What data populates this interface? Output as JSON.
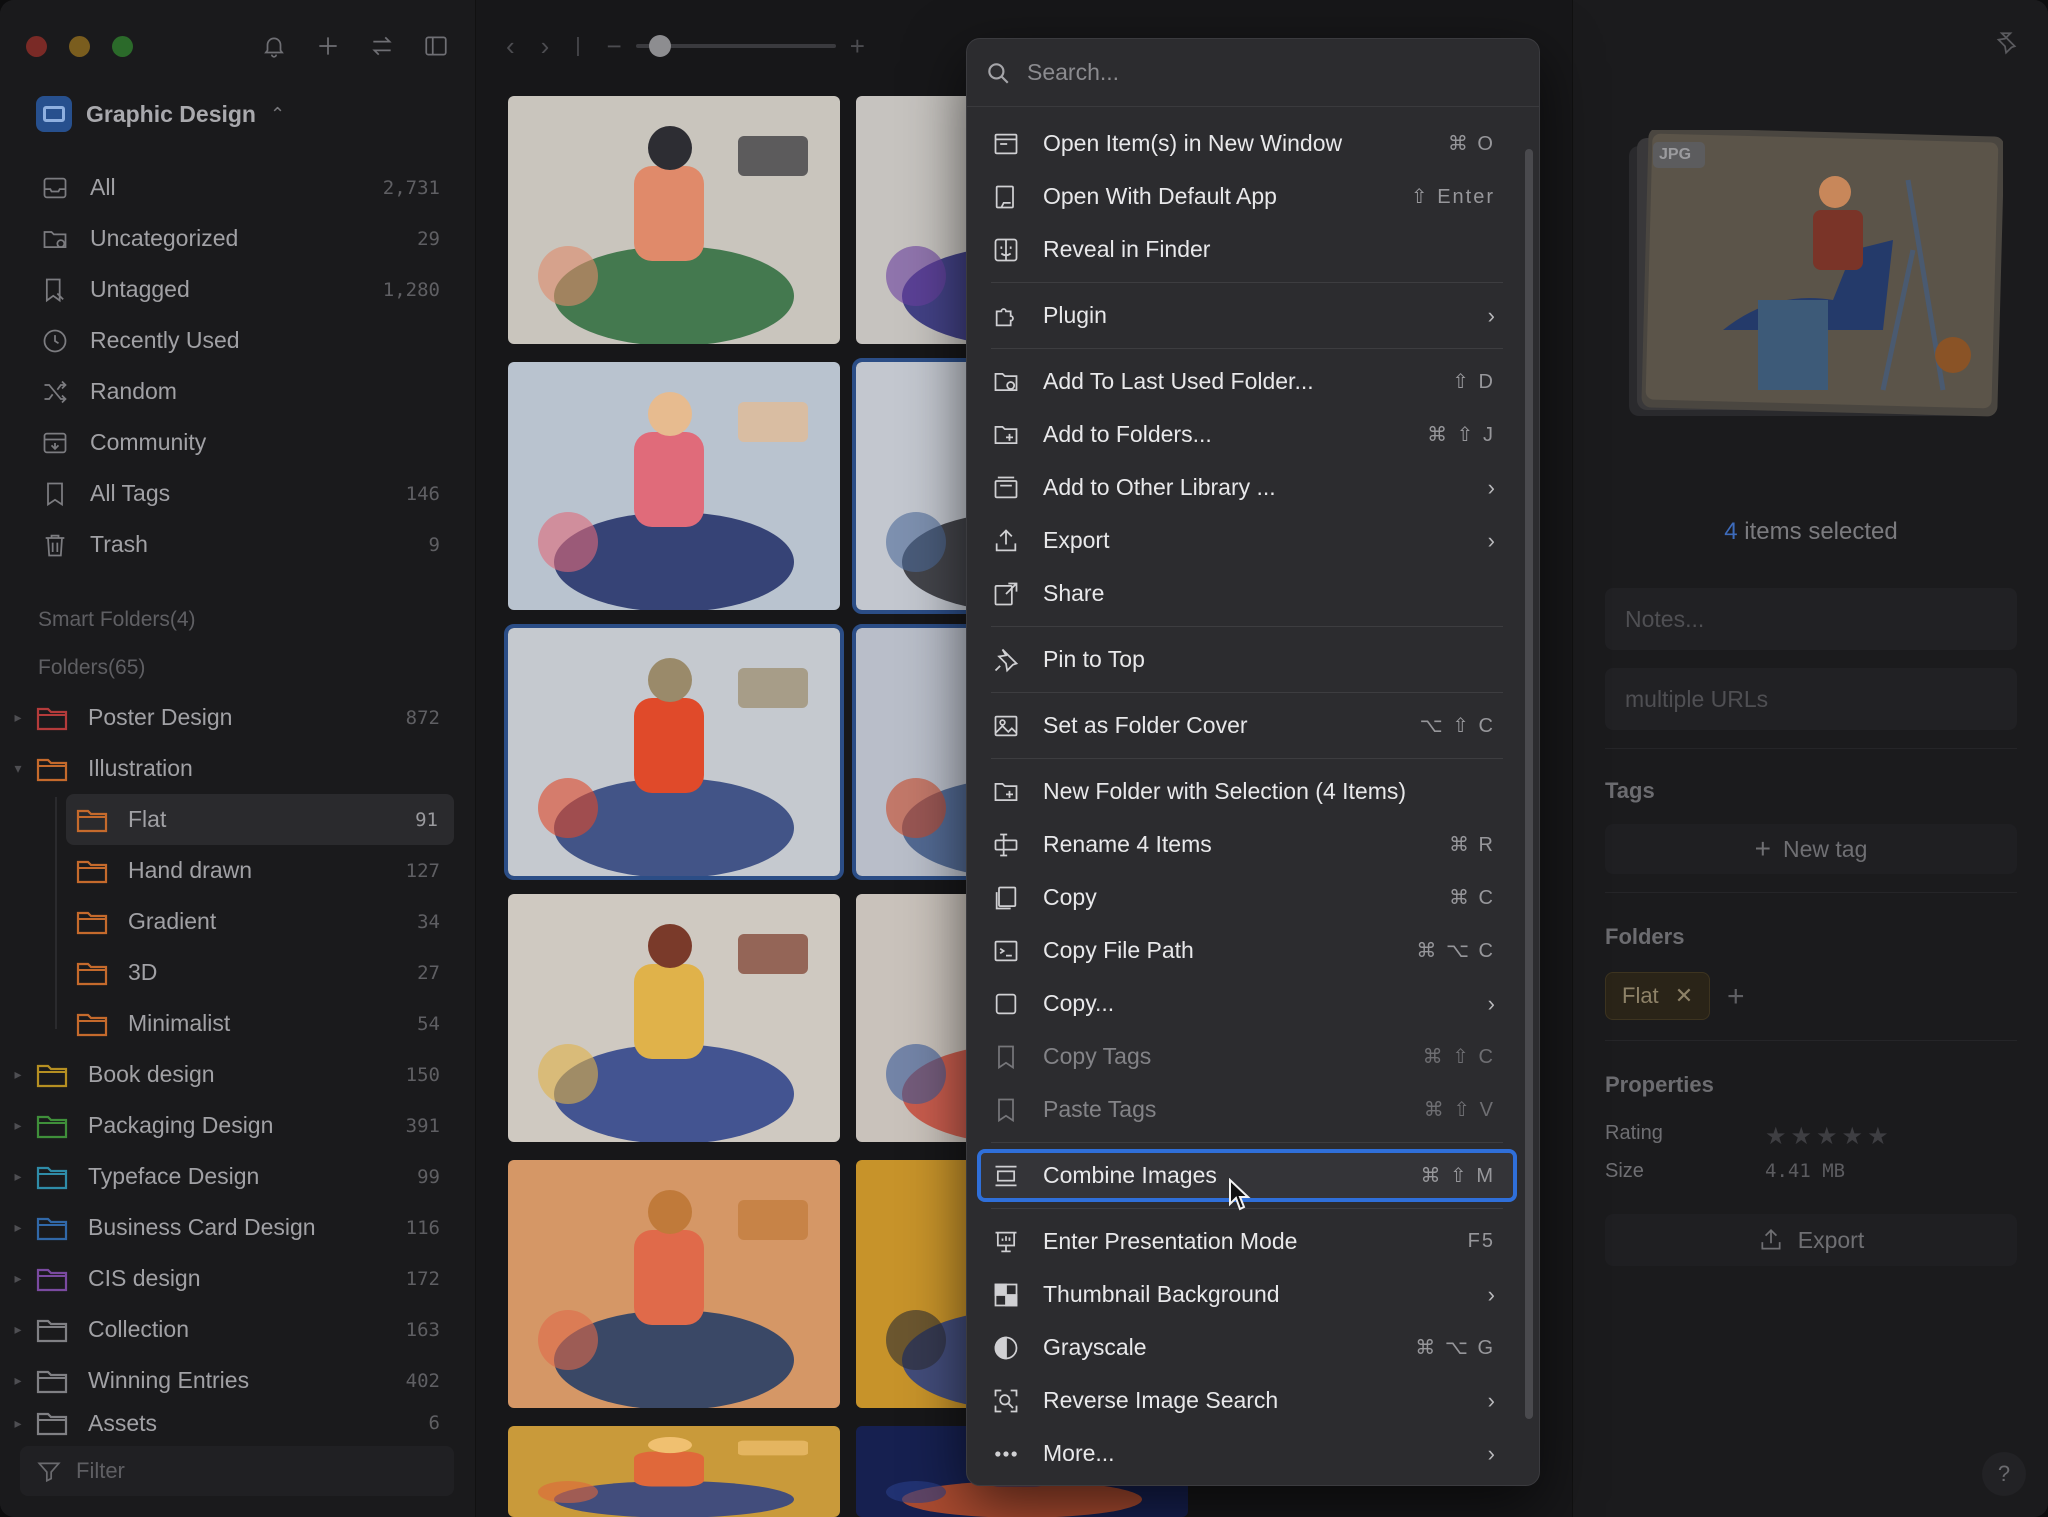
{
  "sidebar": {
    "library_name": "Graphic Design",
    "nav": [
      {
        "label": "All",
        "count": "2,731",
        "icon": "inbox-icon"
      },
      {
        "label": "Uncategorized",
        "count": "29",
        "icon": "folder-question-icon"
      },
      {
        "label": "Untagged",
        "count": "1,280",
        "icon": "tag-off-icon"
      },
      {
        "label": "Recently Used",
        "count": "",
        "icon": "clock-icon"
      },
      {
        "label": "Random",
        "count": "",
        "icon": "shuffle-icon"
      },
      {
        "label": "Community",
        "count": "",
        "icon": "community-icon"
      },
      {
        "label": "All Tags",
        "count": "146",
        "icon": "bookmark-icon"
      },
      {
        "label": "Trash",
        "count": "9",
        "icon": "trash-icon"
      }
    ],
    "smart_folders_label": "Smart Folders(4)",
    "folders_label": "Folders(65)",
    "folders": [
      {
        "label": "Poster Design",
        "count": "872",
        "color": "#b43b3b"
      },
      {
        "label": "Illustration",
        "count": "",
        "color": "#c56a2c"
      },
      {
        "label": "Flat",
        "count": "91",
        "color": "#c56a2c"
      },
      {
        "label": "Hand drawn",
        "count": "127",
        "color": "#c56a2c"
      },
      {
        "label": "Gradient",
        "count": "34",
        "color": "#c56a2c"
      },
      {
        "label": "3D",
        "count": "27",
        "color": "#c56a2c"
      },
      {
        "label": "Minimalist",
        "count": "54",
        "color": "#c56a2c"
      },
      {
        "label": "Book design",
        "count": "150",
        "color": "#b58f22"
      },
      {
        "label": "Packaging Design",
        "count": "391",
        "color": "#3f8f3a"
      },
      {
        "label": "Typeface Design",
        "count": "99",
        "color": "#2f8ca8"
      },
      {
        "label": "Business Card Design",
        "count": "116",
        "color": "#3168a8"
      },
      {
        "label": "CIS design",
        "count": "172",
        "color": "#7a4aa0"
      },
      {
        "label": "Collection",
        "count": "163",
        "color": "#808084"
      },
      {
        "label": "Winning Entries",
        "count": "402",
        "color": "#808084"
      },
      {
        "label": "Assets",
        "count": "6",
        "color": "#808084"
      }
    ],
    "filter_placeholder": "Filter"
  },
  "menu": {
    "search_placeholder": "Search...",
    "items": [
      {
        "label": "Open Item(s) in New Window",
        "shortcut": "⌘ O",
        "icon": "new-window-icon"
      },
      {
        "label": "Open With Default App",
        "shortcut": "⇧ Enter",
        "icon": "open-app-icon"
      },
      {
        "label": "Reveal in Finder",
        "shortcut": "",
        "icon": "finder-icon"
      },
      {
        "label": "Plugin",
        "shortcut": "",
        "icon": "puzzle-icon",
        "submenu": true
      },
      {
        "label": "Add To Last Used Folder...",
        "shortcut": "⇧ D",
        "icon": "folder-clock-icon"
      },
      {
        "label": "Add to Folders...",
        "shortcut": "⌘ ⇧ J",
        "icon": "folder-add-icon"
      },
      {
        "label": "Add to Other Library ...",
        "shortcut": "",
        "icon": "library-icon",
        "submenu": true
      },
      {
        "label": "Export",
        "shortcut": "",
        "icon": "export-icon",
        "submenu": true
      },
      {
        "label": "Share",
        "shortcut": "",
        "icon": "share-icon"
      },
      {
        "label": "Pin to Top",
        "shortcut": "",
        "icon": "pin-icon"
      },
      {
        "label": "Set as Folder Cover",
        "shortcut": "⌥ ⇧ C",
        "icon": "image-icon"
      },
      {
        "label": "New Folder with Selection (4 Items)",
        "shortcut": "",
        "icon": "folder-plus-icon"
      },
      {
        "label": "Rename 4 Items",
        "shortcut": "⌘ R",
        "icon": "rename-icon"
      },
      {
        "label": "Copy",
        "shortcut": "⌘ C",
        "icon": "copy-icon"
      },
      {
        "label": "Copy File Path",
        "shortcut": "⌘ ⌥ C",
        "icon": "terminal-icon"
      },
      {
        "label": "Copy...",
        "shortcut": "",
        "icon": "copy-more-icon",
        "submenu": true
      },
      {
        "label": "Copy Tags",
        "shortcut": "⌘ ⇧ C",
        "icon": "tag-copy-icon",
        "disabled": true
      },
      {
        "label": "Paste Tags",
        "shortcut": "⌘ ⇧ V",
        "icon": "tag-paste-icon",
        "disabled": true
      },
      {
        "label": "Combine Images",
        "shortcut": "⌘ ⇧ M",
        "icon": "combine-icon",
        "highlighted": true
      },
      {
        "label": "Enter Presentation Mode",
        "shortcut": "F5",
        "icon": "presentation-icon"
      },
      {
        "label": "Thumbnail Background",
        "shortcut": "",
        "icon": "checker-icon",
        "submenu": true
      },
      {
        "label": "Grayscale",
        "shortcut": "⌘ ⌥ G",
        "icon": "contrast-icon"
      },
      {
        "label": "Reverse Image Search",
        "shortcut": "",
        "icon": "image-search-icon",
        "submenu": true
      },
      {
        "label": "More...",
        "shortcut": "",
        "icon": "ellipsis-icon",
        "submenu": true
      }
    ]
  },
  "inspector": {
    "badge": "JPG",
    "selected_count": "4",
    "selected_suffix": " items selected",
    "notes_placeholder": "Notes...",
    "urls_placeholder": "multiple URLs",
    "tags_label": "Tags",
    "new_tag_label": "New tag",
    "folders_label": "Folders",
    "folder_chip": "Flat",
    "properties_label": "Properties",
    "rating_label": "Rating",
    "rating_value": 0,
    "size_label": "Size",
    "size_value": "4.41 MB",
    "export_label": "Export"
  },
  "grid": {
    "zoom_level": 0.12,
    "thumbnails": [
      {
        "selected": false
      },
      {
        "selected": false
      },
      {
        "selected": false
      },
      {
        "selected": true
      },
      {
        "selected": true
      },
      {
        "selected": true
      },
      {
        "selected": false
      },
      {
        "selected": false
      },
      {
        "selected": false
      },
      {
        "selected": false
      },
      {
        "selected": false
      },
      {
        "selected": false
      }
    ]
  },
  "colors": {
    "accent": "#2f6fd9",
    "selection": "#2b4d86",
    "highlight_text": "#3d6bbb"
  }
}
